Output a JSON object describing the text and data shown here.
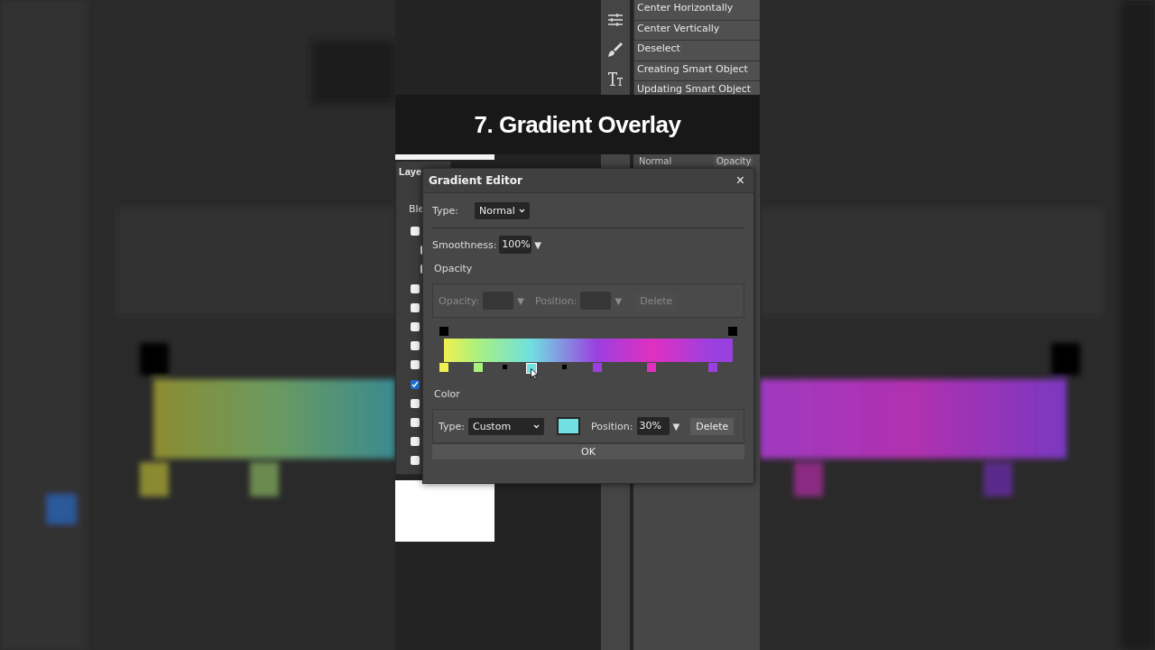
{
  "background": {
    "kind": "picture"
  },
  "menu_items": [
    "Center Horizontally",
    "Center Vertically",
    "Deselect",
    "Creating Smart Object",
    "Updating Smart Object"
  ],
  "caption": "7. Gradient Overlay",
  "layers_bar": {
    "blend_mode": "Normal",
    "opacity_label": "Opacity"
  },
  "layer_styles": {
    "title": "Laye",
    "column_label": "Ble",
    "checkboxes": [
      {
        "checked": false,
        "kind": "top"
      },
      {
        "checked": false,
        "kind": "nested"
      },
      {
        "checked": false,
        "kind": "nested"
      },
      {
        "checked": false,
        "kind": "top"
      },
      {
        "checked": false,
        "kind": "top"
      },
      {
        "checked": false,
        "kind": "top"
      },
      {
        "checked": false,
        "kind": "top"
      },
      {
        "checked": false,
        "kind": "top"
      },
      {
        "checked": true,
        "kind": "top"
      },
      {
        "checked": false,
        "kind": "top"
      },
      {
        "checked": false,
        "kind": "top"
      },
      {
        "checked": false,
        "kind": "top"
      },
      {
        "checked": false,
        "kind": "top"
      }
    ]
  },
  "dialog": {
    "title": "Gradient Editor",
    "close": "×",
    "type_label": "Type:",
    "type_value": "Normal",
    "smoothness_label": "Smoothness:",
    "smoothness_value": "100%",
    "arrow": "▼",
    "opacity_section": {
      "title": "Opacity",
      "disabled": true,
      "opacity_label": "Opacity:",
      "position_label": "Position:",
      "arrow": "▼",
      "delete": "Delete"
    },
    "color_stops": [
      {
        "color": "#f0f050",
        "selected": false
      },
      {
        "color": "#a8f080",
        "selected": false
      },
      {
        "color": "#70e0e0",
        "selected": true
      },
      {
        "color": "#9a40e0",
        "selected": false
      },
      {
        "color": "#e030c0",
        "selected": false
      },
      {
        "color": "#9a40e0",
        "selected": false
      }
    ],
    "color_section": {
      "title": "Color",
      "type_label": "Type:",
      "type_value": "Custom",
      "position_label": "Position:",
      "position_value": "30%",
      "arrow": "▼",
      "delete": "Delete"
    },
    "ok": "OK"
  }
}
